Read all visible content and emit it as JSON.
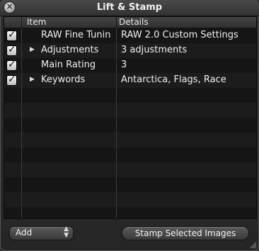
{
  "window": {
    "title": "Lift & Stamp"
  },
  "table": {
    "headers": {
      "item": "Item",
      "details": "Details"
    },
    "rows": [
      {
        "checked": true,
        "expandable": false,
        "item": "RAW Fine Tunin",
        "details": "RAW 2.0 Custom Settings"
      },
      {
        "checked": true,
        "expandable": true,
        "item": "Adjustments",
        "details": "3 adjustments"
      },
      {
        "checked": true,
        "expandable": false,
        "item": "Main Rating",
        "details": "3"
      },
      {
        "checked": true,
        "expandable": true,
        "item": "Keywords",
        "details": "Antarctica, Flags, Race"
      }
    ]
  },
  "footer": {
    "add_label": "Add",
    "stamp_label": "Stamp Selected Images"
  },
  "icons": {
    "close": "close-icon",
    "check": "checkmark-icon",
    "disclosure": "disclosure-triangle-icon",
    "popup": "popup-arrows-icon",
    "resize": "resize-grip-icon"
  },
  "colors": {
    "background": "#262626",
    "row_alt": "#1c1c1c",
    "text": "#f0f0f0"
  }
}
